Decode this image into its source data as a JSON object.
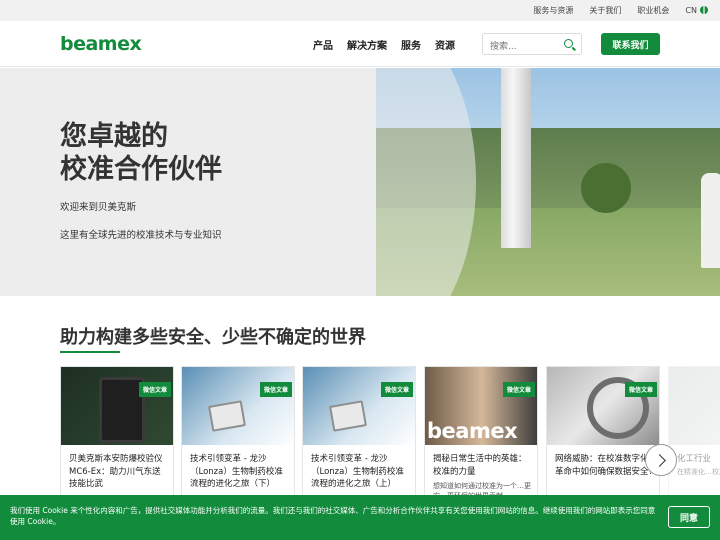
{
  "topbar": {
    "links": [
      "服务与资源",
      "关于我们",
      "职业机会"
    ],
    "language": "CN"
  },
  "header": {
    "logo": "beamex",
    "nav": [
      "产品",
      "解决方案",
      "服务",
      "资源"
    ],
    "search_placeholder": "搜索...",
    "contact_label": "联系我们"
  },
  "hero": {
    "title_line1": "您卓越的",
    "title_line2": "校准合作伙伴",
    "subtitle1": "欢迎来到贝美克斯",
    "subtitle2": "这里有全球先进的校准技术与专业知识"
  },
  "section": {
    "title": "助力构建多些安全、少些不确定的世界"
  },
  "cards": [
    {
      "tag": "微信文章",
      "title": "贝美克斯本安防爆校验仪MC6-Ex：助力川气东送技能比武",
      "desc": ""
    },
    {
      "tag": "微信文章",
      "title": "技术引领变革 - 龙沙（Lonza）生物制药校准流程的进化之旅（下）",
      "desc": ""
    },
    {
      "tag": "微信文章",
      "title": "技术引领变革 - 龙沙（Lonza）生物制药校准流程的进化之旅（上）",
      "desc": ""
    },
    {
      "tag": "微信文章",
      "title": "揭秘日常生活中的英雄：校准的力量",
      "desc": "想知道如何通过校准为一个…更安…更环保的世界贡献…",
      "brand": "beamex"
    },
    {
      "tag": "微信文章",
      "title": "网络威胁：在校准数字化革命中如何确保数据安全?",
      "desc": ""
    },
    {
      "tag": "",
      "title": "化工行业",
      "desc": "在精准化…校准…"
    }
  ],
  "cookie": {
    "text": "我们使用 Cookie 来个性化内容和广告，提供社交媒体功能并分析我们的流量。我们还与我们的社交媒体、广告和分析合作伙伴共享有关您使用我们网站的信息。继续使用我们的网站即表示您同意使用 Cookie。",
    "agree_label": "同意"
  },
  "colors": {
    "brand_green": "#128c3c"
  }
}
